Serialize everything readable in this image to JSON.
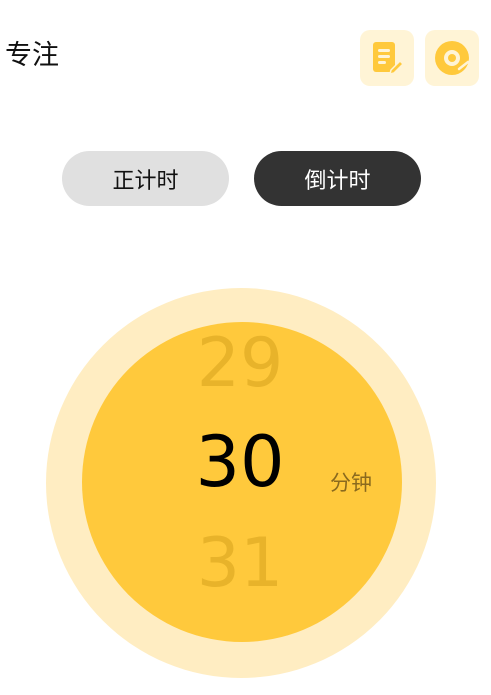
{
  "header": {
    "title": "专注",
    "notes_icon": "notes-edit-icon",
    "disc_icon": "record-disc-icon"
  },
  "modes": {
    "count_up_label": "正计时",
    "count_down_label": "倒计时",
    "selected": "倒计时"
  },
  "picker": {
    "previous_value": "29",
    "current_value": "30",
    "next_value": "31",
    "unit": "分钟"
  },
  "colors": {
    "accent": "#FFC93C",
    "accent_light": "#FFEDC2",
    "icon_bg": "#FFF4D6",
    "inactive_button": "#E0E0E0",
    "active_button": "#333333",
    "faded_number": "#E8B32A",
    "unit_text": "#8A6A1E"
  }
}
